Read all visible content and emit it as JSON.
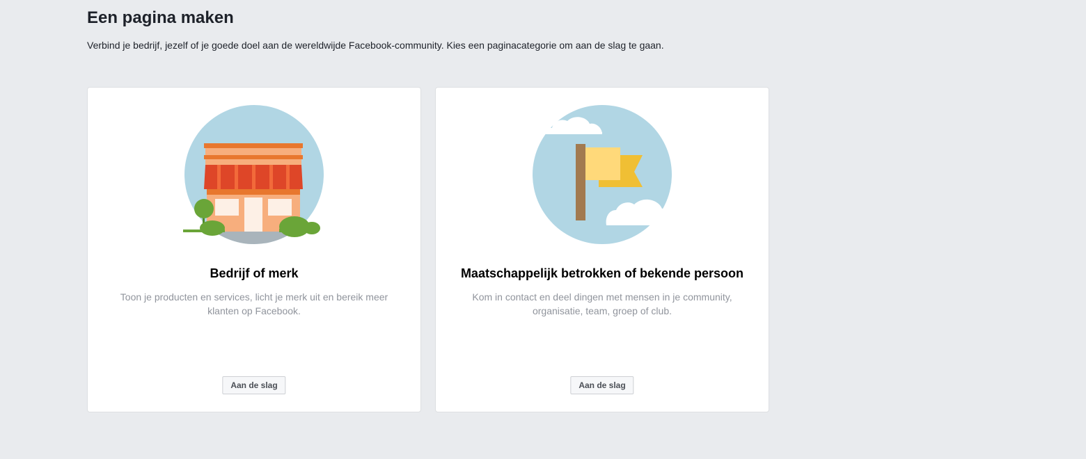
{
  "header": {
    "title": "Een pagina maken",
    "subtitle": "Verbind je bedrijf, jezelf of je goede doel aan de wereldwijde Facebook-community. Kies een paginacategorie om aan de slag te gaan."
  },
  "cards": [
    {
      "icon": "storefront-illustration",
      "title": "Bedrijf of merk",
      "description_lines": [
        "Toon je producten en services, licht je merk uit en bereik meer",
        "klanten op Facebook."
      ],
      "button_label": "Aan de slag"
    },
    {
      "icon": "flag-illustration",
      "title": "Maatschappelijk betrokken of bekende persoon",
      "description_lines": [
        "Kom in contact en deel dingen met mensen in je community,",
        "organisatie, team, groep of club."
      ],
      "button_label": "Aan de slag"
    }
  ],
  "colors": {
    "background": "#e9ebee",
    "card": "#ffffff",
    "sky": "#b1d6e4",
    "awning_red": "#de4628",
    "storefront_orange": "#f7ae7d",
    "bush_green": "#6aa538",
    "flag_yellow": "#ffd97a",
    "flag_dark_yellow": "#f0bf34",
    "pole_brown": "#a27a50"
  }
}
